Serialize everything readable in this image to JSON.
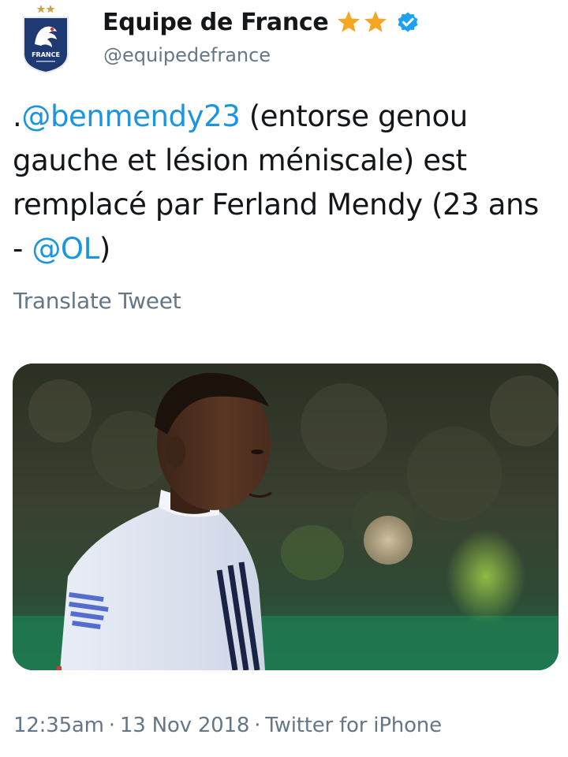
{
  "author": {
    "display_name": "Equipe de France",
    "handle": "@equipedefrance",
    "avatar_icon": "fff-crest-icon",
    "badges": [
      "star-icon",
      "star-icon",
      "verified-icon"
    ],
    "star_color": "#f5a623",
    "verified_color": "#1da1f2",
    "crest_text": "FRANCE"
  },
  "tweet": {
    "prefix": ".",
    "mention_1": "@benmendy23",
    "text_1": " (entorse genou gauche et lésion méniscale) est remplacé par Ferland Mendy (23 ans - ",
    "mention_2": "@OL",
    "text_2": ")",
    "link_color": "#1b95e0"
  },
  "translate": {
    "label": "Translate Tweet"
  },
  "media": {
    "type": "photo",
    "description_icon": "player-photo"
  },
  "meta": {
    "time": "12:35am",
    "date": "13 Nov 2018",
    "source": "Twitter for iPhone",
    "separator": "·"
  }
}
